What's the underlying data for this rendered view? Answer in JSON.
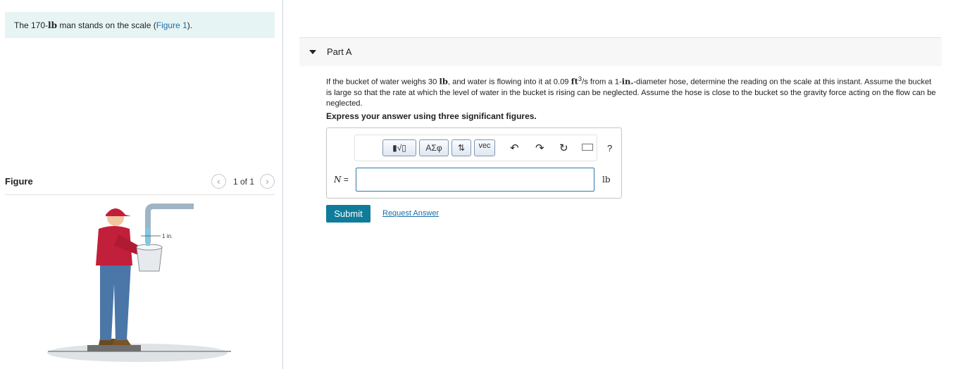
{
  "intro": {
    "prefix": "The 170-",
    "unit": "lb",
    "middle": " man stands on the scale (",
    "figure_link": "Figure 1",
    "suffix": ")."
  },
  "figure_panel": {
    "label": "Figure",
    "pager_text": "1 of 1",
    "prev_icon": "chevron-left-icon",
    "next_icon": "chevron-right-icon",
    "dimension_label": "1 in."
  },
  "part": {
    "title": "Part A",
    "caret_icon": "caret-down-icon"
  },
  "problem": {
    "t1": "If the bucket of water weighs 30 ",
    "u1": "lb",
    "t2": ", and water is flowing into it at 0.09 ",
    "u2": "ft",
    "sup": "3",
    "t3": "/s from a 1-",
    "u3": "in.",
    "t4": "-diameter hose, determine the reading on the scale at this instant. Assume the bucket is large so that the rate at which the level of water in the bucket is rising can be neglected. Assume the hose is close to the bucket so the gravity force acting on the flow can be neglected."
  },
  "instruction": "Express your answer using three significant figures.",
  "toolbar": {
    "template_btn": "▮√▯",
    "symbols_btn": "ΑΣφ",
    "arrows_btn": "⇅",
    "vec_btn": "vec",
    "undo_icon": "undo-icon",
    "redo_icon": "redo-icon",
    "reset_icon": "reset-icon",
    "keyboard_icon": "keyboard-icon",
    "help_label": "?"
  },
  "answer": {
    "variable": "N",
    "equals": " =",
    "value": "",
    "unit": "lb"
  },
  "actions": {
    "submit_label": "Submit",
    "request_label": "Request Answer"
  },
  "colors": {
    "intro_bg": "#e6f4f4",
    "link": "#1a6fa8",
    "submit_bg": "#0f7c9b",
    "input_border": "#2f7aa8"
  }
}
